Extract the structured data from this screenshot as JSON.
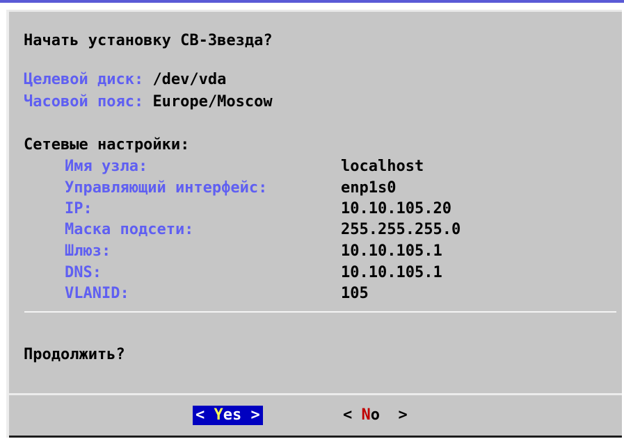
{
  "dialog": {
    "title": "Начать установку СВ-Звезда?",
    "disk": {
      "label": "Целевой диск:",
      "value": "/dev/vda"
    },
    "timezone": {
      "label": "Часовой пояс:",
      "value": "Europe/Moscow"
    },
    "network_heading": "Сетевые настройки:",
    "network": [
      {
        "label": "Имя узла:",
        "value": "localhost"
      },
      {
        "label": "Управляющий интерфейс:",
        "value": "enp1s0"
      },
      {
        "label": "IP:",
        "value": "10.10.105.20"
      },
      {
        "label": "Маска подсети:",
        "value": "255.255.255.0"
      },
      {
        "label": "Шлюз:",
        "value": "10.10.105.1"
      },
      {
        "label": "DNS:",
        "value": "10.10.105.1"
      },
      {
        "label": "VLANID:",
        "value": "105"
      }
    ],
    "prompt": "Продолжить?"
  },
  "buttons": {
    "yes": {
      "open": "< ",
      "hotkey": "Y",
      "rest": "es",
      "close": " >"
    },
    "no": {
      "open": "< ",
      "hotkey": "N",
      "rest": "o",
      "close": "  >"
    }
  },
  "colors": {
    "dialog_bg": "#c6c6c6",
    "label": "#5f5ff2",
    "selected_button_bg": "#0000c0",
    "selected_hotkey": "#ffff55",
    "hotkey": "#c00000"
  }
}
